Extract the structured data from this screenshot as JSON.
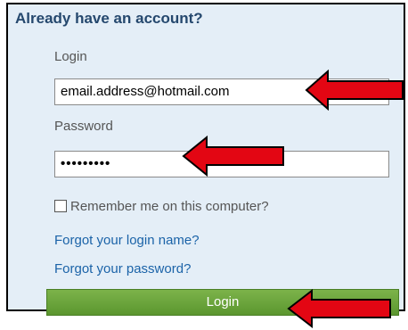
{
  "form": {
    "title": "Already have an account?",
    "login_label": "Login",
    "login_value": "email.address@hotmail.com",
    "password_label": "Password",
    "password_value": "•••••••••",
    "remember_label": "Remember me on this computer?",
    "remember_checked": false,
    "forgot_login_link": "Forgot your login name?",
    "forgot_password_link": "Forgot your password?",
    "login_button": "Login"
  },
  "annotations": {
    "arrow_color": "#e30613",
    "arrows": [
      "red-arrow-icon",
      "red-arrow-icon",
      "red-arrow-icon"
    ]
  },
  "colors": {
    "panel_background": "#e4eef7",
    "title": "#25486e",
    "link": "#1b63a8",
    "button": "#6aa33d"
  }
}
